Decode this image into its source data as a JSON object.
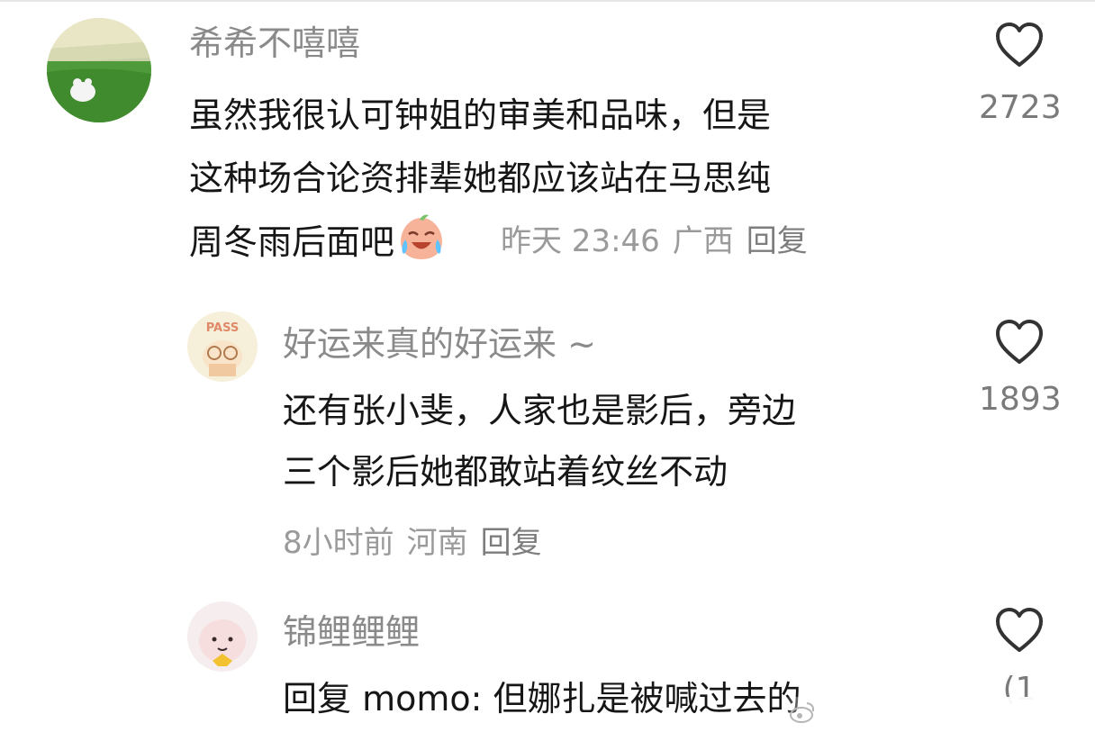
{
  "comments": [
    {
      "username": "希希不嘻嘻",
      "lines": [
        "虽然我很认可钟姐的审美和品味，但是",
        "这种场合论资排辈她都应该站在马思纯",
        "周冬雨后面吧"
      ],
      "emoji": "crying-laughing-peach-emoji",
      "time": "昨天 23:46",
      "location": "广西",
      "reply_label": "回复",
      "likes": "2723"
    },
    {
      "username": "好运来真的好运来 ~",
      "avatar_text": "PASS",
      "lines": [
        "还有张小斐，人家也是影后，旁边",
        "三个影后她都敢站着纹丝不动"
      ],
      "time": "8小时前",
      "location": "河南",
      "reply_label": "回复",
      "likes": "1893"
    },
    {
      "username": "锦鲤鲤鲤",
      "lines": [
        "回复 momo: 但娜扎是被喊过去的"
      ],
      "likes": "(1"
    }
  ],
  "colors": {
    "username": "#8a8a8a",
    "body": "#161616",
    "meta": "#9a9a9a",
    "heart_stroke": "#333333"
  },
  "icons": {
    "like": "heart-outline-icon"
  }
}
